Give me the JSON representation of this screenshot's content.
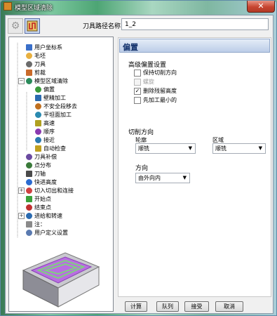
{
  "window": {
    "title": "模型区域清除",
    "close_glyph": "✕"
  },
  "toolbar": {
    "tool_path_label": "刀具路径名称",
    "tool_path_value": "1_2"
  },
  "tree": {
    "items": [
      {
        "label": "用户坐标系",
        "icon": "coordinate-system-icon"
      },
      {
        "label": "毛坯",
        "icon": "block-icon"
      },
      {
        "label": "刀具",
        "icon": "tool-icon"
      },
      {
        "label": "剪裁",
        "icon": "trim-icon"
      },
      {
        "label": "模型区域清除",
        "icon": "area-clearance-icon",
        "expand": "−"
      },
      {
        "label": "偏置",
        "icon": "offset-icon"
      },
      {
        "label": "壁精加工",
        "icon": "wall-finishing-icon"
      },
      {
        "label": "不安全段移去",
        "icon": "unsafe-segment-icon"
      },
      {
        "label": "平坦面加工",
        "icon": "flat-machining-icon"
      },
      {
        "label": "高速",
        "icon": "high-speed-icon"
      },
      {
        "label": "顺序",
        "icon": "order-icon"
      },
      {
        "label": "接近",
        "icon": "approach-icon"
      },
      {
        "label": "自动检查",
        "icon": "auto-verify-icon"
      },
      {
        "label": "刀具补偿",
        "icon": "tool-compensation-icon"
      },
      {
        "label": "点分布",
        "icon": "point-distribution-icon"
      },
      {
        "label": "刀轴",
        "icon": "tool-axis-icon"
      },
      {
        "label": "快进高度",
        "icon": "rapid-height-icon"
      },
      {
        "label": "切入切出和连接",
        "icon": "leads-links-icon",
        "expand": "+"
      },
      {
        "label": "开始点",
        "icon": "start-point-icon"
      },
      {
        "label": "结束点",
        "icon": "end-point-icon"
      },
      {
        "label": "进给和转速",
        "icon": "feeds-speeds-icon",
        "expand": "+"
      },
      {
        "label": "注：",
        "icon": "notes-icon"
      },
      {
        "label": "用户定义设置",
        "icon": "user-settings-icon"
      }
    ]
  },
  "panel": {
    "heading": "偏置",
    "advanced_group": "高级偏置设置",
    "checkboxes": [
      {
        "label": "保持切削方向",
        "checked": false,
        "disabled": false
      },
      {
        "label": "螺旋",
        "checked": false,
        "disabled": true
      },
      {
        "label": "删除残留高度",
        "checked": true,
        "disabled": false
      },
      {
        "label": "先加工最小的",
        "checked": false,
        "disabled": false
      }
    ],
    "cut_direction_group": "切削方向",
    "profile_label": "轮廓",
    "profile_value": "顺铣",
    "area_label": "区域",
    "area_value": "顺铣",
    "direction_label": "方向",
    "direction_value": "由外向内"
  },
  "buttons": {
    "calculate": "计算",
    "queue": "队列",
    "accept": "接受",
    "cancel": "取消"
  }
}
